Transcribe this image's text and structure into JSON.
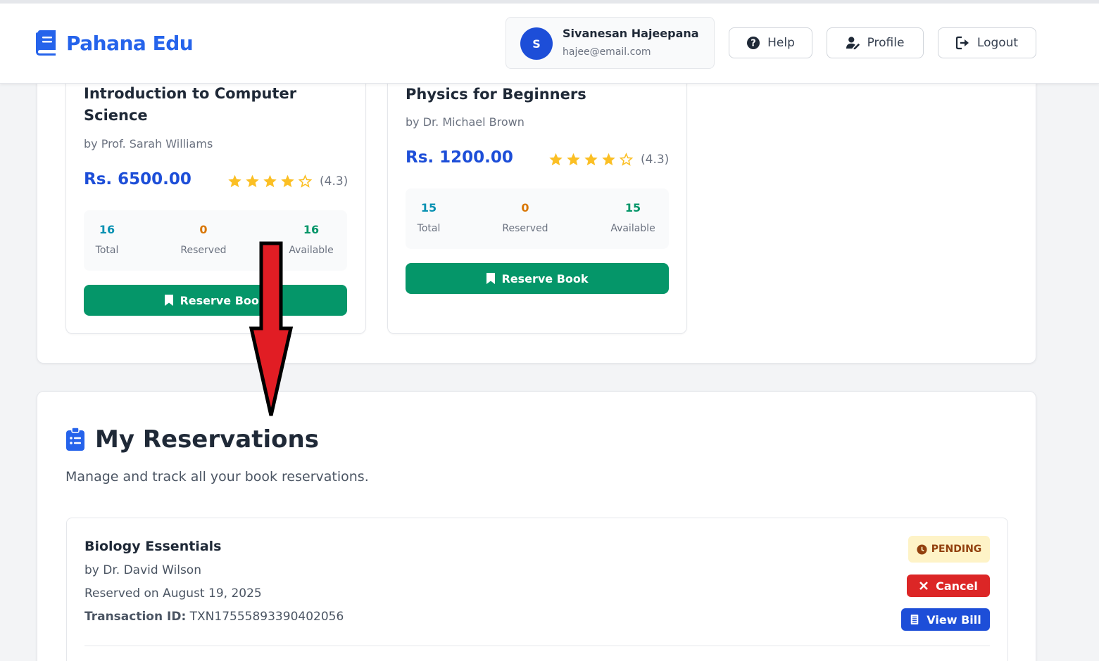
{
  "header": {
    "brand": "Pahana Edu",
    "user": {
      "initial": "S",
      "name": "Sivanesan Hajeepana",
      "email": "hajee@email.com"
    },
    "buttons": {
      "help": "Help",
      "profile": "Profile",
      "logout": "Logout"
    }
  },
  "books": [
    {
      "title": "Introduction to Computer Science",
      "author": "by Prof. Sarah Williams",
      "price": "Rs. 6500.00",
      "rating_text": "(4.3)",
      "rating_value": 4.3,
      "stats": {
        "total": "16",
        "total_label": "Total",
        "reserved": "0",
        "reserved_label": "Reserved",
        "available": "16",
        "available_label": "Available"
      },
      "button": "Reserve Book"
    },
    {
      "title": "Physics for Beginners",
      "author": "by Dr. Michael Brown",
      "price": "Rs. 1200.00",
      "rating_text": "(4.3)",
      "rating_value": 4.3,
      "stats": {
        "total": "15",
        "total_label": "Total",
        "reserved": "0",
        "reserved_label": "Reserved",
        "available": "15",
        "available_label": "Available"
      },
      "button": "Reserve Book"
    }
  ],
  "reservations": {
    "title": "My Reservations",
    "subtitle": "Manage and track all your book reservations.",
    "items": [
      {
        "title": "Biology Essentials",
        "author": "by Dr. David Wilson",
        "reserved_on": "Reserved on August 19, 2025",
        "transaction_label": "Transaction ID:",
        "transaction_id": "TXN17555893390402056",
        "status": "PENDING",
        "cancel": "Cancel",
        "view_bill": "View Bill"
      }
    ]
  },
  "colors": {
    "primary": "#2563eb",
    "success": "#059669",
    "danger": "#dc2626",
    "warning_bg": "#fef3c7",
    "star": "#fbbf24",
    "arrow": "#e11d24"
  },
  "icons": [
    "book-icon",
    "help-circle-icon",
    "user-edit-icon",
    "logout-icon",
    "star-icon",
    "bookmark-icon",
    "clipboard-list-icon",
    "clock-icon",
    "x-icon",
    "receipt-icon",
    "down-arrow-annotation"
  ]
}
